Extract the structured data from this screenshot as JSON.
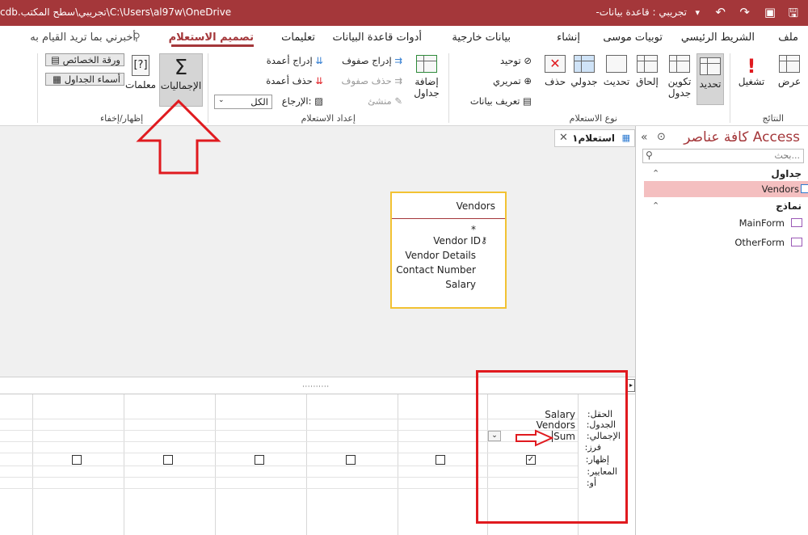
{
  "titlebar": {
    "title": "تجريبي : قاعدة بيانات- ",
    "path": "cdb.تجريبي\\سطح المكتب\\C:\\Users\\al97w\\OneDrive"
  },
  "tabs": [
    {
      "label": "ملف"
    },
    {
      "label": "الشريط الرئيسي"
    },
    {
      "label": "توبيات موسى"
    },
    {
      "label": "إنشاء"
    },
    {
      "label": "بيانات خارجية"
    },
    {
      "label": "أدوات قاعدة البيانات"
    },
    {
      "label": "تعليمات"
    },
    {
      "label": "تصميم الاستعلام"
    },
    {
      "label": "أخبرني بما تريد القيام به"
    }
  ],
  "ribbon": {
    "results": {
      "group": "النتائج",
      "view": "عرض",
      "run": "تشغيل"
    },
    "query_type": {
      "group": "نوع الاستعلام",
      "select": "تحديد",
      "make_table": "تكوين",
      "make_table2": "جدول",
      "append": "إلحاق",
      "update": "تحديث",
      "crosstab": "جدولي",
      "delete": "حذف",
      "union": "توحيد",
      "pass_through": "تمريري",
      "data_definition": "تعريف بيانات"
    },
    "query_setup": {
      "group": "إعداد الاستعلام",
      "add_tables": "إضافة",
      "add_tables2": "جداول",
      "insert_rows": "إدراج صفوف",
      "delete_rows": "حذف صفوف",
      "builder": "منشئ",
      "insert_columns": "إدراج أعمدة",
      "delete_columns": "حذف أعمدة",
      "return_label": "الإرجاع:",
      "return_value": "الكل"
    },
    "show_hide": {
      "group": "إظهار/إخفاء",
      "totals": "الإجماليات",
      "parameters": "معلمات",
      "property_sheet": "ورقة الخصائص",
      "table_names": "أسماء الجداول"
    }
  },
  "document_tab": {
    "label": "استعلام١"
  },
  "vendors_table": {
    "title": "Vendors",
    "fields": [
      "*",
      "Vendor ID",
      "Vendor Details",
      "Contact Number",
      "Salary"
    ]
  },
  "grid": {
    "row_labels": [
      "الحقل:",
      "الجدول:",
      "الإجمالي:",
      "فرز:",
      "إظهار:",
      "المعايير:",
      "أو:"
    ],
    "field": "Salary",
    "table": "Vendors",
    "total": "Sum"
  },
  "navpane": {
    "title": "كافة عناصر Access",
    "search_placeholder": "بحث...",
    "sections": [
      {
        "label": "جداول",
        "items": [
          "Vendors"
        ]
      },
      {
        "label": "نماذج",
        "items": [
          "MainForm",
          "OtherForm"
        ]
      }
    ]
  },
  "colors": {
    "brand": "#a4373a",
    "annotation": "#e01a1f",
    "table_highlight": "#f2c233"
  }
}
